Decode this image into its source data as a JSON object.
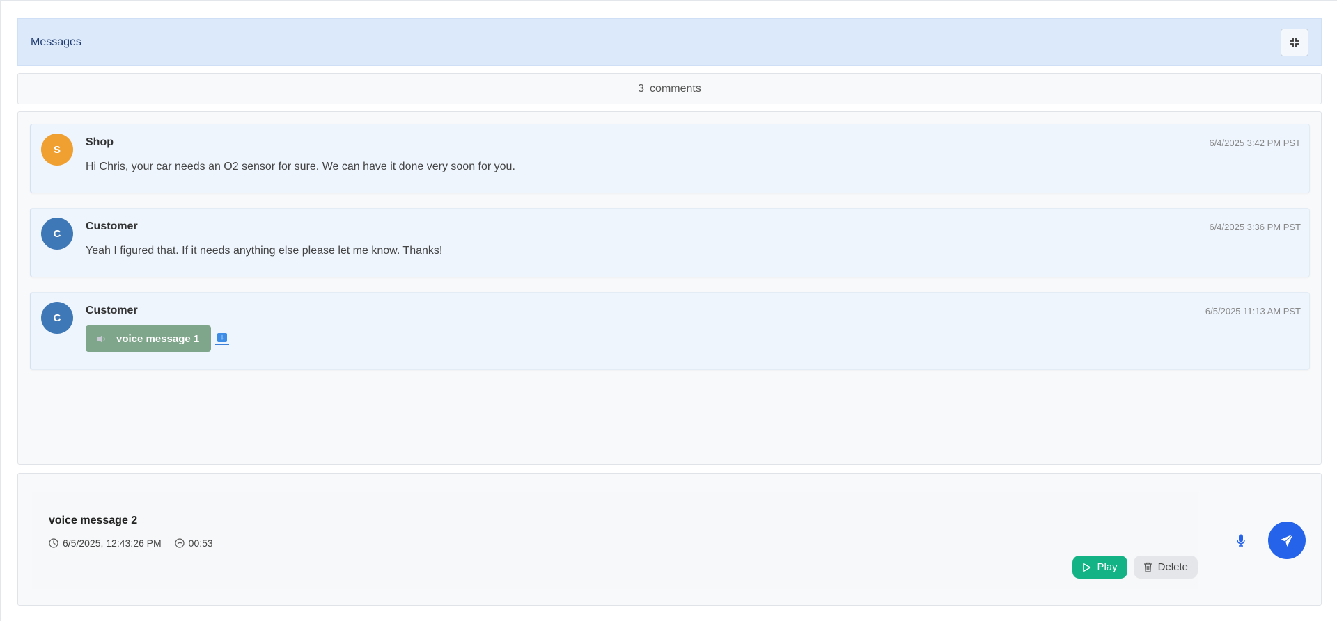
{
  "header": {
    "title": "Messages",
    "collapse_icon": "collapse-icon"
  },
  "comments": {
    "count": "3",
    "label": "comments"
  },
  "messages": [
    {
      "author": "Shop",
      "initial": "S",
      "avatar_color": "#f0a030",
      "timestamp": "6/4/2025 3:42 PM PST",
      "text": "Hi Chris, your car needs an O2 sensor for sure. We can have it done very soon for you."
    },
    {
      "author": "Customer",
      "initial": "C",
      "avatar_color": "#3f78b6",
      "timestamp": "6/4/2025 3:36 PM PST",
      "text": "Yeah I figured that. If it needs anything else please let me know. Thanks!"
    },
    {
      "author": "Customer",
      "initial": "C",
      "avatar_color": "#3f78b6",
      "timestamp": "6/5/2025 11:13 AM PST",
      "voice_label": "voice message 1",
      "voice_icon": "speaker-icon",
      "download_icon": "download-icon"
    }
  ],
  "composer": {
    "draft_title": "voice message 2",
    "recorded_at": "6/5/2025, 12:43:26 PM",
    "duration": "00:53",
    "play_label": "Play",
    "delete_label": "Delete",
    "mic_icon": "microphone-icon",
    "send_icon": "send-icon"
  },
  "colors": {
    "header_bg": "#dbe9fb",
    "accent": "#2563eb",
    "play": "#13b385",
    "voice_pill": "#7fa68b"
  }
}
